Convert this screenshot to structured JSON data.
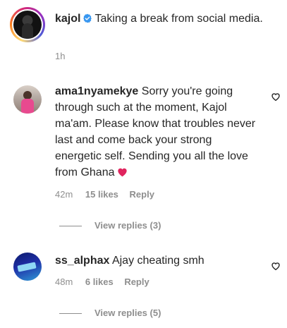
{
  "post": {
    "username": "kajol",
    "caption": "Taking a break from social media.",
    "time": "1h"
  },
  "comments": [
    {
      "username": "ama1nyamekye",
      "text": "Sorry you're going through such at the moment, Kajol ma'am. Please know that troubles never last and come back your strong energetic self. Sending you all the love from Ghana",
      "time": "42m",
      "likes": "15 likes",
      "reply_label": "Reply",
      "view_replies": "View replies (3)"
    },
    {
      "username": "ss_alphax",
      "text": "Ajay cheating smh",
      "time": "48m",
      "likes": "6 likes",
      "reply_label": "Reply",
      "view_replies": "View replies (5)"
    }
  ],
  "colors": {
    "text": "#262626",
    "secondary": "#8e8e8e",
    "verified": "#3897f0",
    "heart_emoji": "#e0245e"
  },
  "icons": {
    "verified": "verified-badge-icon",
    "like": "heart-outline-icon",
    "emoji": "red-heart-emoji-icon"
  }
}
